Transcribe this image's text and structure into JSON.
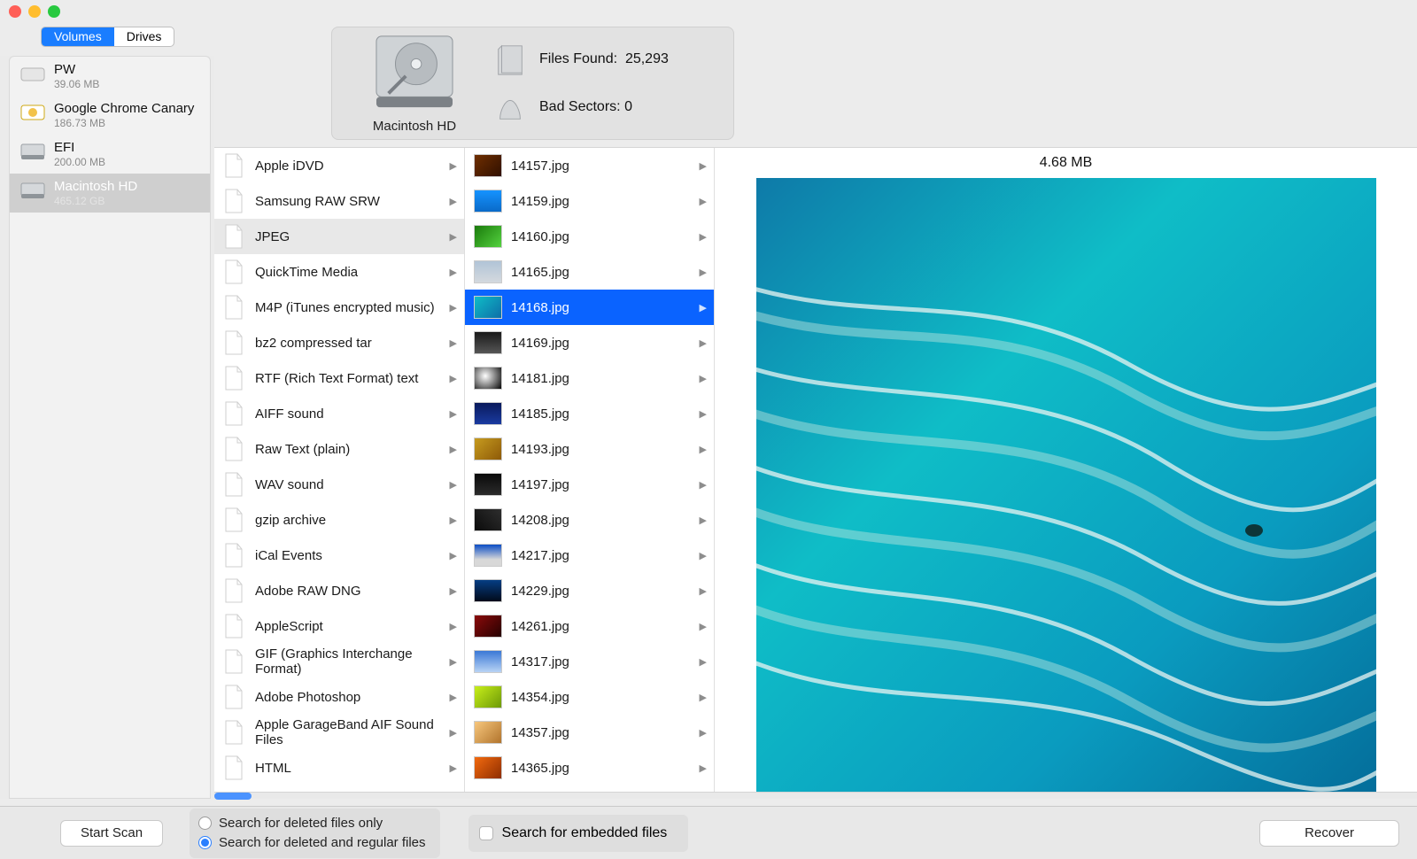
{
  "segmented": {
    "volumes": "Volumes",
    "drives": "Drives",
    "active": "volumes"
  },
  "volumes": [
    {
      "name": "PW",
      "size": "39.06 MB",
      "icon": "ext"
    },
    {
      "name": "Google Chrome Canary",
      "size": "186.73 MB",
      "icon": "dmg"
    },
    {
      "name": "EFI",
      "size": "200.00 MB",
      "icon": "int"
    },
    {
      "name": "Macintosh HD",
      "size": "465.12 GB",
      "icon": "int",
      "selected": true
    }
  ],
  "scan_drive": {
    "name": "Macintosh HD"
  },
  "stats": {
    "files_found_label": "Files Found:",
    "files_found_value": "25,293",
    "bad_sectors_label": "Bad Sectors:",
    "bad_sectors_value": "0"
  },
  "filetypes": [
    {
      "label": "Apple iDVD"
    },
    {
      "label": "Samsung RAW SRW"
    },
    {
      "label": "JPEG",
      "selected": true
    },
    {
      "label": "QuickTime Media"
    },
    {
      "label": "M4P (iTunes encrypted music)"
    },
    {
      "label": "bz2 compressed tar"
    },
    {
      "label": "RTF (Rich Text Format) text"
    },
    {
      "label": "AIFF sound"
    },
    {
      "label": "Raw Text (plain)"
    },
    {
      "label": "WAV sound"
    },
    {
      "label": "gzip archive"
    },
    {
      "label": "iCal Events"
    },
    {
      "label": "Adobe RAW DNG"
    },
    {
      "label": "AppleScript"
    },
    {
      "label": "GIF (Graphics Interchange Format)"
    },
    {
      "label": "Adobe Photoshop"
    },
    {
      "label": "Apple GarageBand AIF Sound Files"
    },
    {
      "label": "HTML"
    }
  ],
  "files": [
    {
      "name": "14157.jpg",
      "th": "th1"
    },
    {
      "name": "14159.jpg",
      "th": "th2"
    },
    {
      "name": "14160.jpg",
      "th": "th3"
    },
    {
      "name": "14165.jpg",
      "th": "th4"
    },
    {
      "name": "14168.jpg",
      "th": "th5",
      "selected": true
    },
    {
      "name": "14169.jpg",
      "th": "th6"
    },
    {
      "name": "14181.jpg",
      "th": "th7"
    },
    {
      "name": "14185.jpg",
      "th": "th8"
    },
    {
      "name": "14193.jpg",
      "th": "th9"
    },
    {
      "name": "14197.jpg",
      "th": "th10"
    },
    {
      "name": "14208.jpg",
      "th": "th11"
    },
    {
      "name": "14217.jpg",
      "th": "th12"
    },
    {
      "name": "14229.jpg",
      "th": "th13"
    },
    {
      "name": "14261.jpg",
      "th": "th14"
    },
    {
      "name": "14317.jpg",
      "th": "th15"
    },
    {
      "name": "14354.jpg",
      "th": "th16"
    },
    {
      "name": "14357.jpg",
      "th": "th17"
    },
    {
      "name": "14365.jpg",
      "th": "th18"
    }
  ],
  "preview": {
    "size": "4.68 MB"
  },
  "footer": {
    "start_scan": "Start Scan",
    "opt_deleted_only": "Search for deleted files only",
    "opt_deleted_regular": "Search for deleted and regular files",
    "opt_embedded": "Search for embedded files",
    "selected_radio": "deleted_regular",
    "recover": "Recover"
  }
}
